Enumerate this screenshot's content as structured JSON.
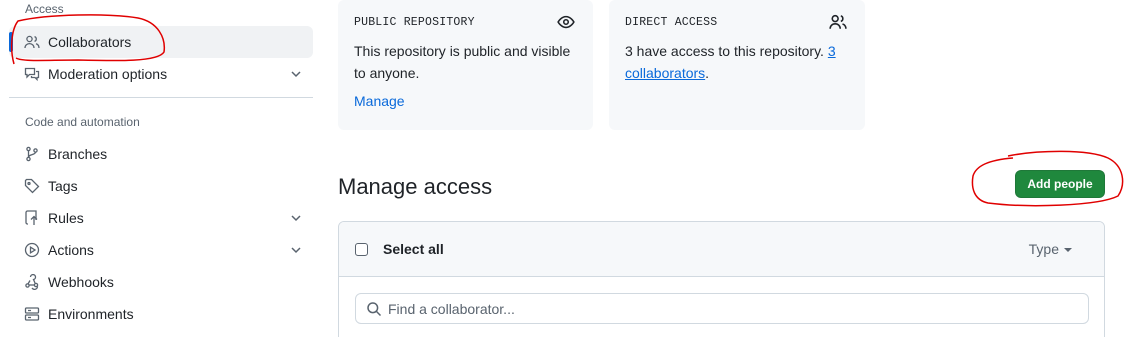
{
  "sidebar": {
    "access_heading": "Access",
    "access_items": [
      {
        "label": "Collaborators",
        "icon": "people-icon",
        "active": true
      },
      {
        "label": "Moderation options",
        "icon": "comment-discussion-icon",
        "expandable": true
      }
    ],
    "code_heading": "Code and automation",
    "code_items": [
      {
        "label": "Branches",
        "icon": "git-branch-icon"
      },
      {
        "label": "Tags",
        "icon": "tag-icon"
      },
      {
        "label": "Rules",
        "icon": "repo-push-icon",
        "expandable": true
      },
      {
        "label": "Actions",
        "icon": "play-icon",
        "expandable": true
      },
      {
        "label": "Webhooks",
        "icon": "webhook-icon"
      },
      {
        "label": "Environments",
        "icon": "server-icon"
      }
    ]
  },
  "cards": {
    "public": {
      "title": "PUBLIC REPOSITORY",
      "text": "This repository is public and visible to anyone.",
      "link": "Manage",
      "icon": "eye-icon"
    },
    "direct": {
      "title": "DIRECT ACCESS",
      "text_prefix": "3 have access to this repository.",
      "link": "3 collaborators",
      "text_suffix": ".",
      "icon": "people-icon"
    }
  },
  "manage": {
    "title": "Manage access",
    "add_button": "Add people",
    "select_all": "Select all",
    "type_filter": "Type",
    "search_placeholder": "Find a collaborator..."
  },
  "colors": {
    "accent": "#0969da",
    "primary_button": "#1f883d",
    "annotation": "#e00000"
  }
}
